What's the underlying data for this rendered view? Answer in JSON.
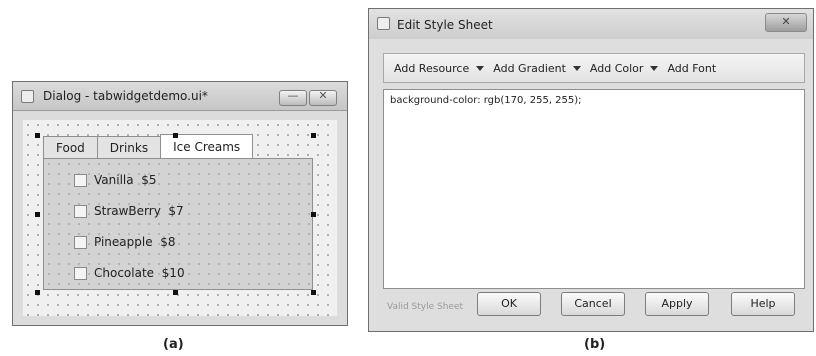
{
  "dialog": {
    "title": "Dialog - tabwidgetdemo.ui*",
    "title_icon": "dialog-icon",
    "window_buttons": [
      {
        "name": "minimize",
        "glyph": "—"
      },
      {
        "name": "close",
        "glyph": "✕"
      }
    ],
    "tabs": [
      {
        "label": "Food",
        "active": false
      },
      {
        "label": "Drinks",
        "active": false
      },
      {
        "label": "Ice Creams",
        "active": true
      }
    ],
    "items": [
      {
        "label": "Vanilla  $5",
        "checked": false
      },
      {
        "label": "StrawBerry  $7",
        "checked": false
      },
      {
        "label": "Pineapple  $8",
        "checked": false
      },
      {
        "label": "Chocolate  $10",
        "checked": false
      }
    ]
  },
  "editor": {
    "title": "Edit Style Sheet",
    "close_glyph": "✕",
    "toolbar": [
      {
        "label": "Add Resource",
        "has_dropdown": true
      },
      {
        "label": "Add Gradient",
        "has_dropdown": true
      },
      {
        "label": "Add Color",
        "has_dropdown": true
      },
      {
        "label": "Add Font",
        "has_dropdown": false
      }
    ],
    "stylesheet_text": "background-color: rgb(170, 255, 255);",
    "status": "Valid Style Sheet",
    "buttons": {
      "ok": "OK",
      "cancel": "Cancel",
      "apply": "Apply",
      "help": "Help"
    }
  },
  "captions": {
    "a": "(a)",
    "b": "(b)"
  }
}
